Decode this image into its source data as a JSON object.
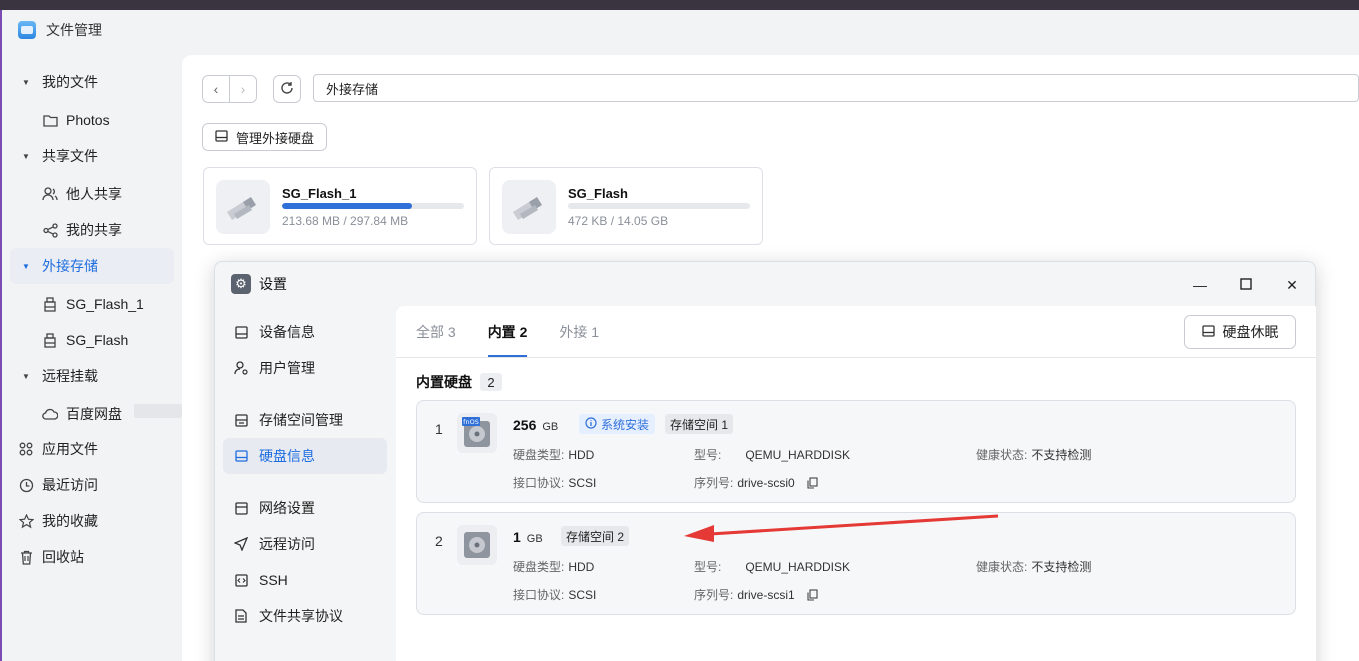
{
  "app": {
    "title": "文件管理"
  },
  "sidebar": {
    "items": [
      {
        "label": "我的文件",
        "icon": "caret-down-icon",
        "type": "group"
      },
      {
        "label": "Photos",
        "icon": "folder-icon",
        "type": "sub"
      },
      {
        "label": "共享文件",
        "icon": "caret-down-icon",
        "type": "group"
      },
      {
        "label": "他人共享",
        "icon": "users-icon",
        "type": "sub"
      },
      {
        "label": "我的共享",
        "icon": "share-icon",
        "type": "sub"
      },
      {
        "label": "外接存储",
        "icon": "caret-down-icon",
        "type": "group",
        "active": true
      },
      {
        "label": "SG_Flash_1",
        "icon": "usb-drive-icon",
        "type": "sub"
      },
      {
        "label": "SG_Flash",
        "icon": "usb-drive-icon",
        "type": "sub"
      },
      {
        "label": "远程挂载",
        "icon": "caret-down-icon",
        "type": "group"
      },
      {
        "label": "百度网盘",
        "icon": "cloud-icon",
        "type": "sub"
      },
      {
        "label": "应用文件",
        "icon": "apps-icon",
        "type": "top"
      },
      {
        "label": "最近访问",
        "icon": "clock-icon",
        "type": "top"
      },
      {
        "label": "我的收藏",
        "icon": "star-icon",
        "type": "top"
      },
      {
        "label": "回收站",
        "icon": "trash-icon",
        "type": "top"
      }
    ]
  },
  "toolbar": {
    "path": "外接存储",
    "manage_label": "管理外接硬盘"
  },
  "drives": [
    {
      "name": "SG_Flash_1",
      "size": "213.68 MB / 297.84 MB",
      "used_fraction": 0.717
    },
    {
      "name": "SG_Flash",
      "size": "472 KB / 14.05 GB",
      "used_fraction": 0.0
    }
  ],
  "settings": {
    "title": "设置",
    "nav": [
      {
        "label": "设备信息",
        "icon": "device-icon"
      },
      {
        "label": "用户管理",
        "icon": "user-settings-icon"
      },
      {
        "label": "存储空间管理",
        "icon": "storage-icon"
      },
      {
        "label": "硬盘信息",
        "icon": "hdd-icon",
        "active": true
      },
      {
        "label": "网络设置",
        "icon": "network-icon"
      },
      {
        "label": "远程访问",
        "icon": "send-icon"
      },
      {
        "label": "SSH",
        "icon": "code-icon"
      },
      {
        "label": "文件共享协议",
        "icon": "file-protocol-icon"
      }
    ],
    "tabs": [
      {
        "label": "全部 3"
      },
      {
        "label": "内置 2",
        "active": true
      },
      {
        "label": "外接 1"
      }
    ],
    "sleep_label": "硬盘休眠",
    "section": {
      "title": "内置硬盘",
      "count": "2"
    },
    "disks": [
      {
        "index": "1",
        "size": "256",
        "unit": "GB",
        "system_badge": "系统安装",
        "pool_badge": "存储空间 1",
        "os_label": "fnOS",
        "type_k": "硬盘类型:",
        "type_v": "HDD",
        "model_k": "型号:",
        "model_v": "QEMU_HARDDISK",
        "health_k": "健康状态:",
        "health_v": "不支持检测",
        "iface_k": "接口协议:",
        "iface_v": "SCSI",
        "serial_k": "序列号:",
        "serial_v": "drive-scsi0"
      },
      {
        "index": "2",
        "size": "1",
        "unit": "GB",
        "pool_badge": "存储空间 2",
        "type_k": "硬盘类型:",
        "type_v": "HDD",
        "model_k": "型号:",
        "model_v": "QEMU_HARDDISK",
        "health_k": "健康状态:",
        "health_v": "不支持检测",
        "iface_k": "接口协议:",
        "iface_v": "SCSI",
        "serial_k": "序列号:",
        "serial_v": "drive-scsi1"
      }
    ]
  },
  "colors": {
    "accent": "#2e6fd8",
    "annotation_arrow": "#e53935"
  }
}
